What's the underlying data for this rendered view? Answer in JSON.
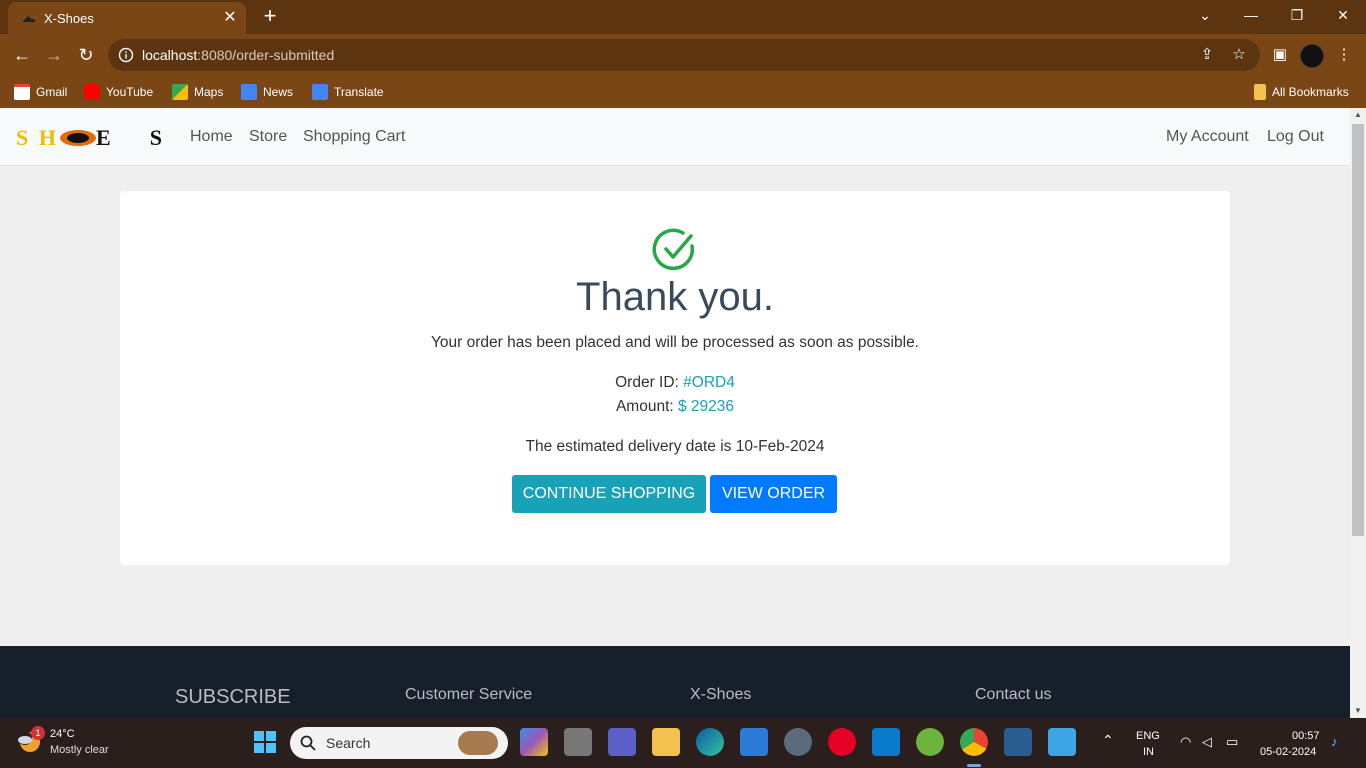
{
  "browser": {
    "tab_title": "X-Shoes",
    "url_host": "localhost",
    "url_rest": ":8080/order-submitted",
    "bookmarks": [
      "Gmail",
      "YouTube",
      "Maps",
      "News",
      "Translate"
    ],
    "all_bookmarks": "All Bookmarks"
  },
  "nav": {
    "logo": "SHOES",
    "links": [
      "Home",
      "Store",
      "Shopping Cart"
    ],
    "right_links": [
      "My Account",
      "Log Out"
    ]
  },
  "order": {
    "heading": "Thank you.",
    "message": "Your order has been placed and will be processed as soon as possible.",
    "order_id_label": "Order ID: ",
    "order_id": "#ORD4",
    "amount_label": "Amount: ",
    "amount": "$ 29236",
    "delivery": "The estimated delivery date is 10-Feb-2024",
    "continue_label": "CONTINUE SHOPPING",
    "view_label": "VIEW ORDER"
  },
  "footer": {
    "headings": [
      "SUBSCRIBE",
      "Customer Service",
      "X-Shoes",
      "Contact us"
    ]
  },
  "taskbar": {
    "weather_temp": "24°C",
    "weather_desc": "Mostly clear",
    "weather_badge": "1",
    "search_placeholder": "Search",
    "lang_1": "ENG",
    "lang_2": "IN",
    "time": "00:57",
    "date": "05-02-2024"
  },
  "colors": {
    "browser_frame": "#7a4616",
    "accent_info": "#17a2b8",
    "accent_primary": "#007bff",
    "success": "#28a745",
    "footer_bg": "#17202a"
  }
}
